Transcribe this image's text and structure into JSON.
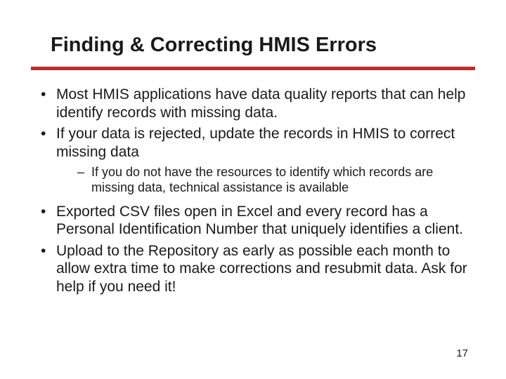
{
  "title": "Finding & Correcting HMIS Errors",
  "bullets": {
    "b1": "Most HMIS applications have data quality reports that can help identify records with missing data.",
    "b2": "If your data is rejected, update the records in HMIS to correct missing data",
    "b2_sub1": "If you do not have the resources to identify which records are missing data, technical assistance is available",
    "b3": "Exported CSV files open in Excel and every record has a Personal Identification Number that uniquely identifies a client.",
    "b4": "Upload to the Repository as early as possible each month to allow extra time to make corrections and resubmit data.  Ask for help if you need it!"
  },
  "page_number": "17"
}
